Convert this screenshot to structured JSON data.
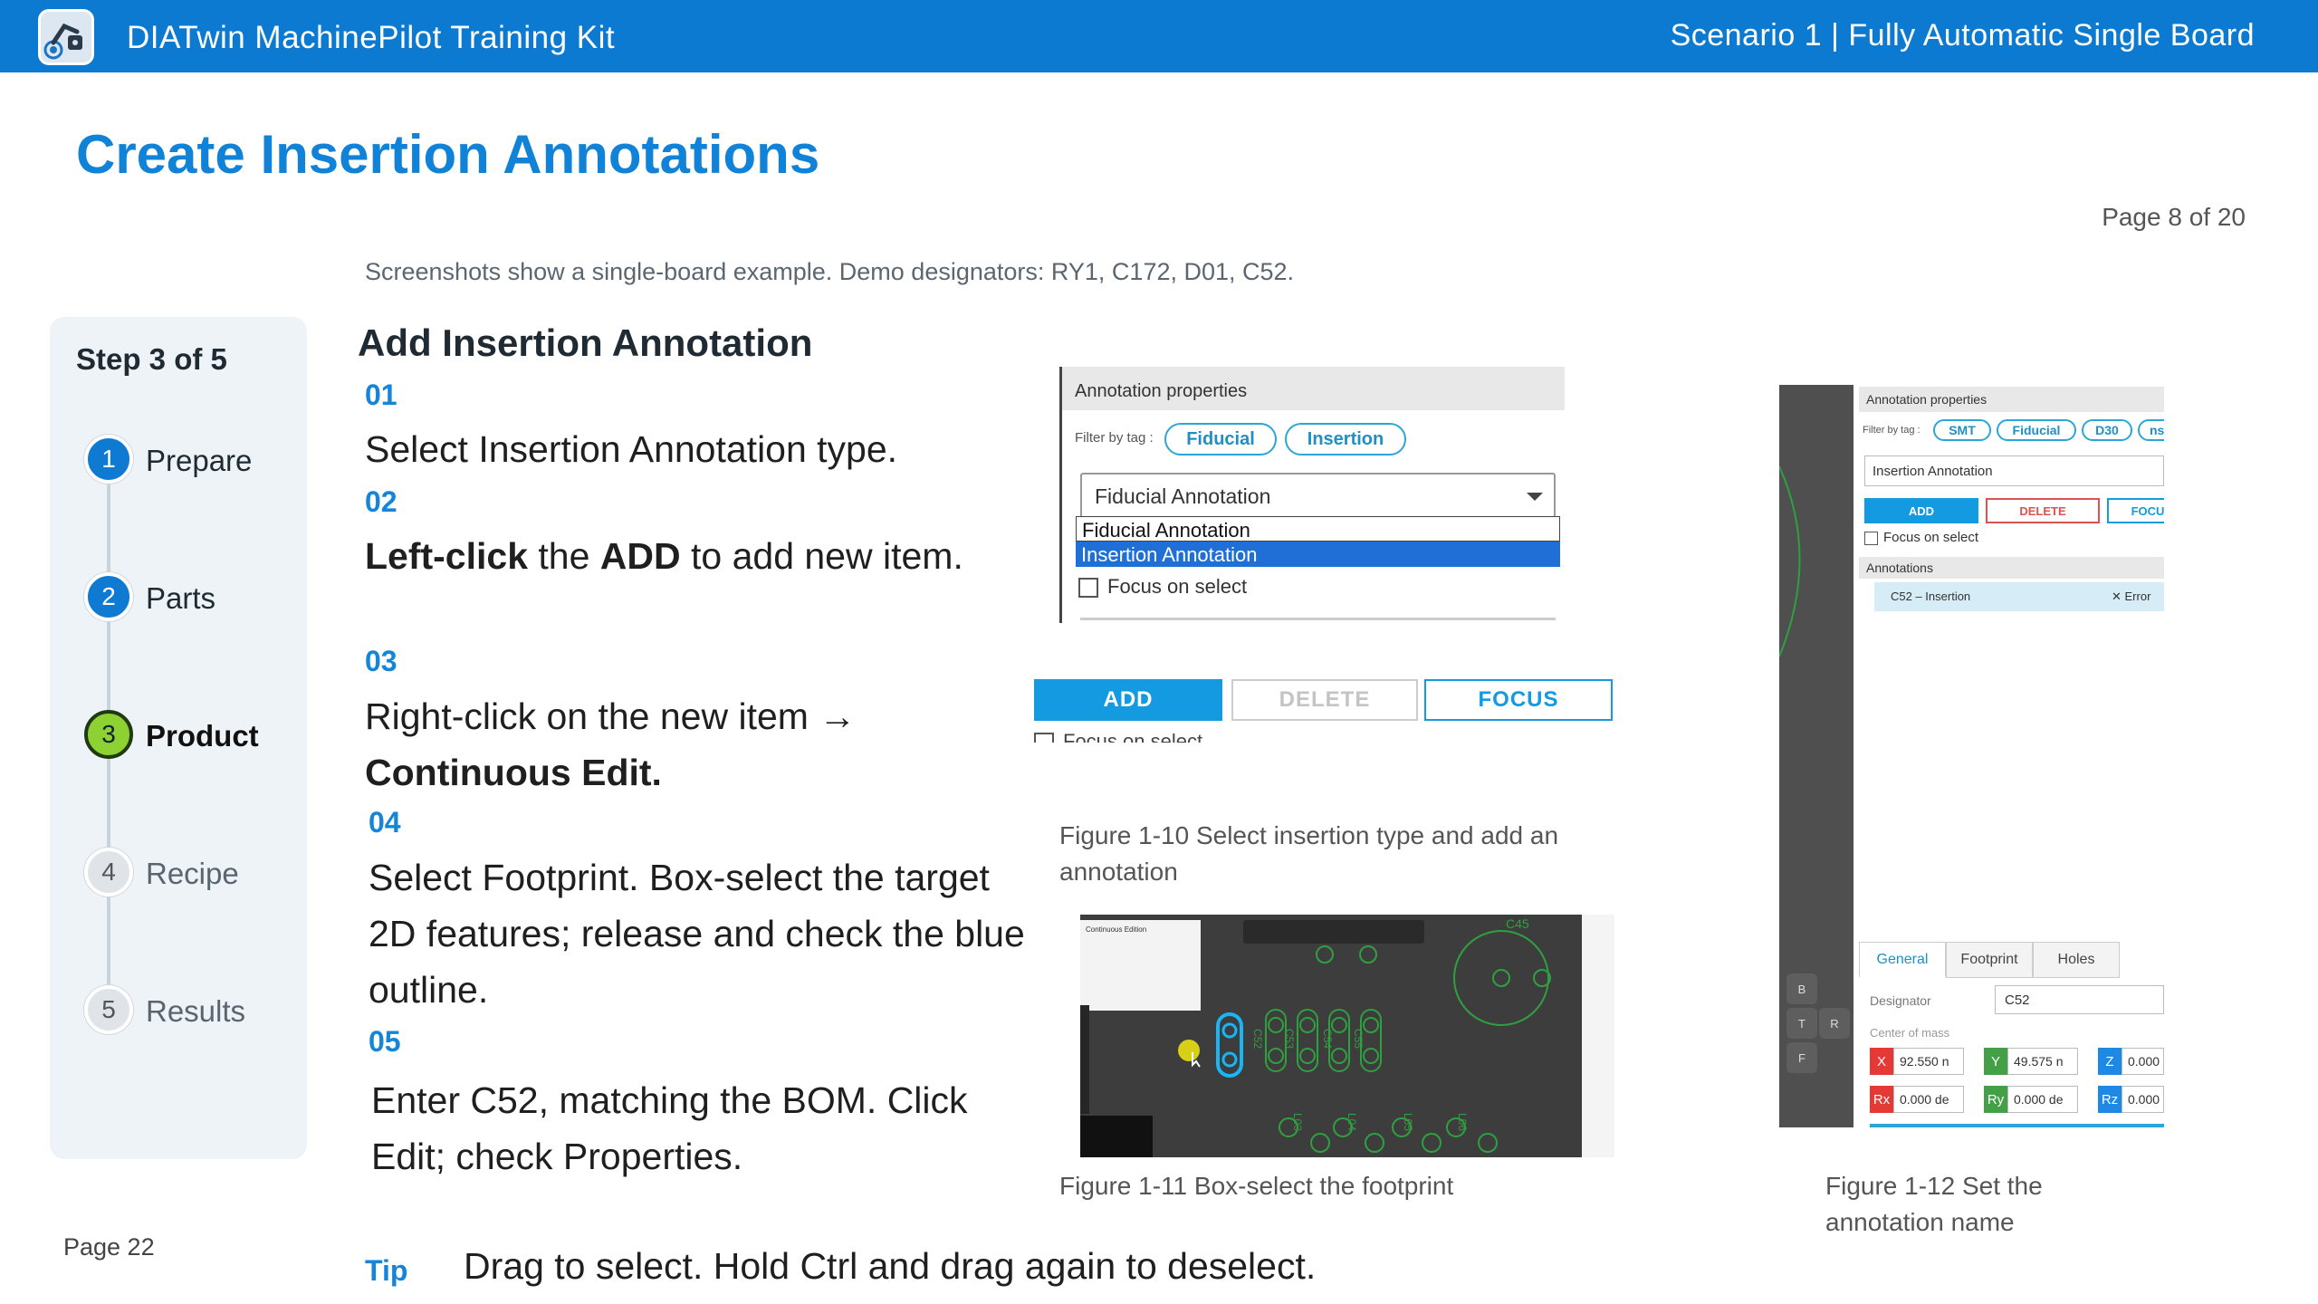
{
  "header": {
    "app_title": "DIATwin MachinePilot Training Kit",
    "scenario": "Scenario 1 | Fully Automatic Single Board",
    "logo_icon": "robot-arm-icon",
    "bar_color": "#0c7ad0"
  },
  "page": {
    "title": "Create Insertion Annotations",
    "page_of": "Page 8 of 20",
    "subtitle": "Screenshots show a single-board example. Demo designators: RY1, C172, D01, C52.",
    "footer_page": "Page 22",
    "accent_color": "#1083d8"
  },
  "stepper": {
    "header": "Step 3 of 5",
    "steps": [
      {
        "num": "1",
        "label": "Prepare",
        "state": "done"
      },
      {
        "num": "2",
        "label": "Parts",
        "state": "done"
      },
      {
        "num": "3",
        "label": "Product",
        "state": "active"
      },
      {
        "num": "4",
        "label": "Recipe",
        "state": "todo"
      },
      {
        "num": "5",
        "label": "Results",
        "state": "todo"
      }
    ]
  },
  "instructions": {
    "section_title": "Add Insertion Annotation",
    "s01": {
      "num": "01",
      "text": "Select Insertion Annotation type."
    },
    "s02": {
      "num": "02",
      "bold1": "Left-click",
      "mid": " the ",
      "bold2": "ADD",
      "end": " to add new item."
    },
    "s03": {
      "num": "03",
      "line1": "Right-click on the new item →",
      "line2": "Continuous Edit."
    },
    "s04": {
      "num": "04",
      "line1": "Select Footprint. Box-select the target",
      "line2": "2D features; release and check the blue",
      "line3": "outline."
    },
    "s05": {
      "num": "05",
      "line1": "Enter C52, matching the BOM. Click",
      "line2": "Edit; check Properties."
    },
    "tip_label": "Tip",
    "tip_text": "Drag to select. Hold Ctrl and drag again to deselect."
  },
  "figure1": {
    "header": "Annotation properties",
    "filter_label": "Filter by tag :",
    "chips": [
      "Fiducial",
      "Insertion"
    ],
    "select_value": "Fiducial Annotation",
    "options": [
      "Fiducial Annotation",
      "Insertion Annotation"
    ],
    "focus_label": "Focus on select",
    "buttons": {
      "add": "ADD",
      "delete": "DELETE",
      "focus": "FOCUS"
    },
    "partial_text": "Focus on select",
    "caption_line1": "Figure 1-10  Select insertion type and add an",
    "caption_line2": "annotation"
  },
  "figure2": {
    "panel_title": "Continuous Edition",
    "labels": [
      "C52",
      "C53",
      "C54",
      "C55",
      "C45",
      "L03",
      "L04",
      "L05",
      "L06"
    ],
    "caption": "Figure 1-11  Box-select the footprint"
  },
  "figure3": {
    "header": "Annotation properties",
    "filter_label": "Filter by tag :",
    "chips": [
      "SMT",
      "Fiducial",
      "D30",
      "nse"
    ],
    "select_value": "Insertion Annotation",
    "buttons": {
      "add": "ADD",
      "delete": "DELETE",
      "focus": "FOCU"
    },
    "focus_label": "Focus on select",
    "annotations_header": "Annotations",
    "annotation_row": "C52 – Insertion",
    "annotation_status": "✕ Error",
    "tabs": [
      "General",
      "Footprint",
      "Holes"
    ],
    "designator_label": "Designator",
    "designator_value": "C52",
    "center_label": "Center of mass",
    "coords": [
      {
        "k": "X",
        "v": "92.550 n"
      },
      {
        "k": "Y",
        "v": "49.575 n"
      },
      {
        "k": "Z",
        "v": "0.000"
      },
      {
        "k": "Rx",
        "v": "0.000 de"
      },
      {
        "k": "Ry",
        "v": "0.000 de"
      },
      {
        "k": "Rz",
        "v": "0.000"
      }
    ],
    "nav": [
      "B",
      "T",
      "R",
      "F"
    ],
    "caption_line1": "Figure 1-12  Set the",
    "caption_line2": "annotation name"
  }
}
